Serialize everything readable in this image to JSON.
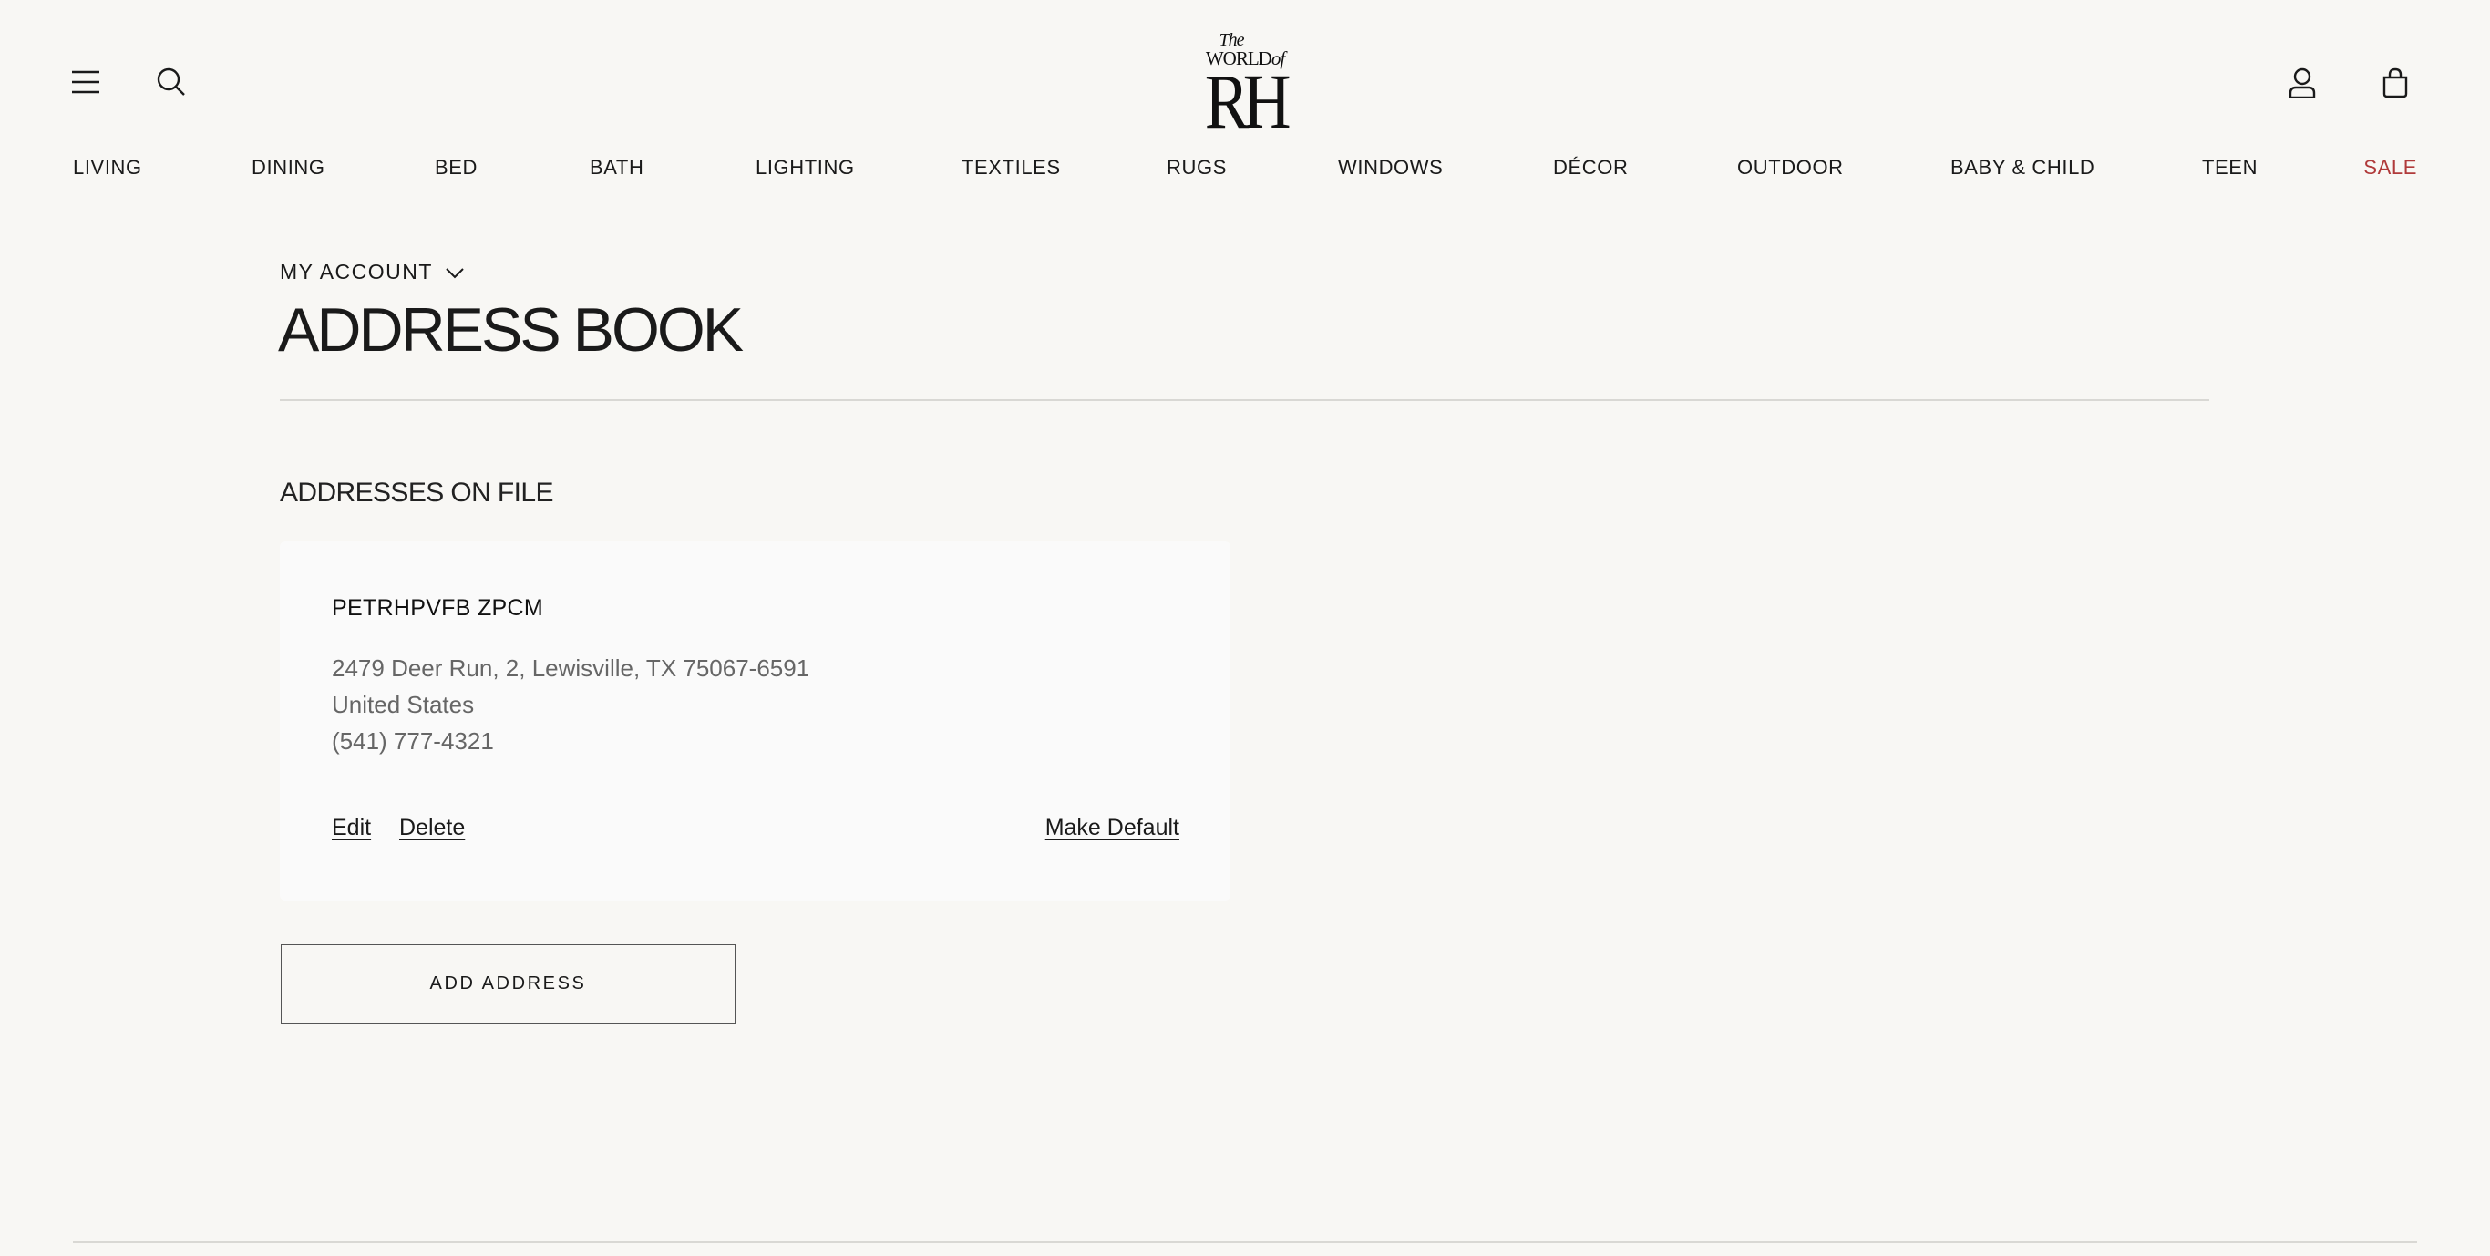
{
  "header": {
    "menu_icon": "hamburger-menu-icon",
    "search_icon": "search-icon",
    "account_icon": "user-icon",
    "cart_icon": "shopping-bag-icon",
    "logo": {
      "the": "The",
      "world": "WORLD",
      "of": "of",
      "rh": "RH"
    }
  },
  "nav": {
    "items": [
      {
        "label": "LIVING"
      },
      {
        "label": "DINING"
      },
      {
        "label": "BED"
      },
      {
        "label": "BATH"
      },
      {
        "label": "LIGHTING"
      },
      {
        "label": "TEXTILES"
      },
      {
        "label": "RUGS"
      },
      {
        "label": "WINDOWS"
      },
      {
        "label": "DÉCOR"
      },
      {
        "label": "OUTDOOR"
      },
      {
        "label": "BABY & CHILD"
      },
      {
        "label": "TEEN"
      },
      {
        "label": "SALE",
        "color": "#b03a3a"
      }
    ]
  },
  "account": {
    "dropdown_label": "MY ACCOUNT",
    "page_title": "ADDRESS BOOK",
    "section_title": "ADDRESSES ON FILE"
  },
  "address": {
    "name": "PETRHPVFB ZPCM",
    "street": "2479 Deer Run, 2, Lewisville, TX 75067-6591",
    "country": "United States",
    "phone": "(541) 777-4321",
    "edit_label": "Edit",
    "delete_label": "Delete",
    "make_default_label": "Make Default"
  },
  "add_address_label": "ADD ADDRESS"
}
